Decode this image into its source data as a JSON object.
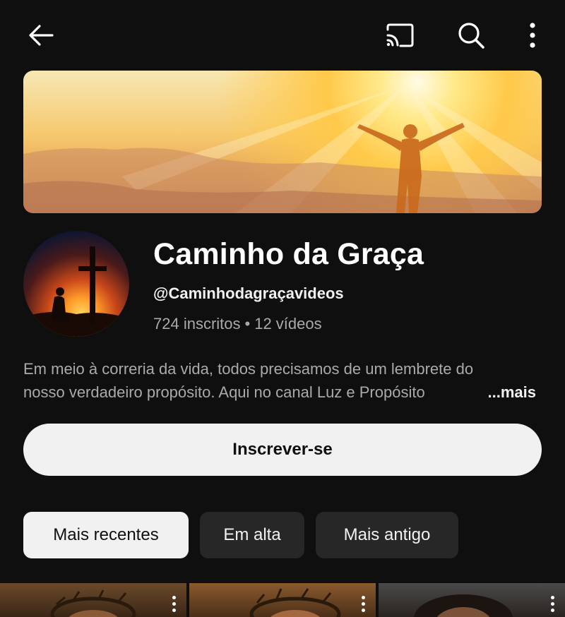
{
  "topbar": {
    "back_icon": "arrow-left-icon",
    "cast_icon": "cast-icon",
    "search_icon": "search-icon",
    "more_icon": "more-vertical-icon"
  },
  "channel": {
    "name": "Caminho da Graça",
    "handle": "@Caminhodagraçavideos",
    "subscribers": "724 inscritos",
    "separator": "•",
    "videos": "12 vídeos",
    "description_line1": "Em meio à correria da vida, todos precisamos de um lembrete do",
    "description_line2": "nosso verdadeiro propósito. Aqui no canal Luz e Propósito",
    "more_label": "...mais"
  },
  "subscribe": {
    "label": "Inscrever-se"
  },
  "filters": {
    "chips": [
      {
        "label": "Mais recentes",
        "selected": true
      },
      {
        "label": "Em alta",
        "selected": false
      },
      {
        "label": "Mais antigo",
        "selected": false
      }
    ]
  },
  "colors": {
    "background": "#0f0f0f",
    "text_primary": "#f1f1f1",
    "text_secondary": "#aaaaaa",
    "chip_inactive": "#272727"
  }
}
